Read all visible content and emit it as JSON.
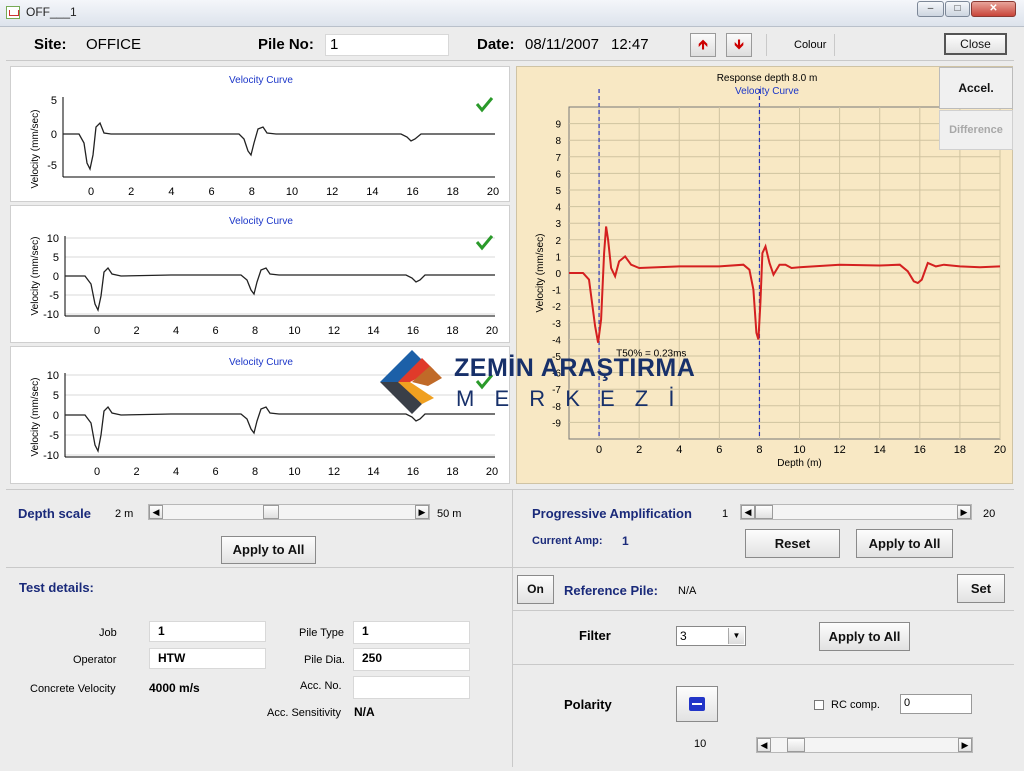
{
  "window": {
    "title": "OFF___1"
  },
  "header": {
    "site_label": "Site:",
    "site_value": "OFFICE",
    "pile_label": "Pile No:",
    "pile_value": "1",
    "date_label": "Date:",
    "date_value": "08/11/2007",
    "time_value": "12:47",
    "colour_label": "Colour",
    "close_label": "Close"
  },
  "small_charts": [
    {
      "title": "Velocity Curve",
      "ylabel": "Velocity (mm/sec)",
      "yticks": [
        "5",
        "0",
        "-5"
      ],
      "xticks": [
        "0",
        "2",
        "4",
        "6",
        "8",
        "10",
        "12",
        "14",
        "16",
        "18",
        "20"
      ],
      "checked": true
    },
    {
      "title": "Velocity Curve",
      "ylabel": "Velocity (mm/sec)",
      "yticks": [
        "10",
        "5",
        "0",
        "-5",
        "-10"
      ],
      "xticks": [
        "0",
        "2",
        "4",
        "6",
        "8",
        "10",
        "12",
        "14",
        "16",
        "18",
        "20"
      ],
      "checked": true
    },
    {
      "title": "Velocity Curve",
      "ylabel": "Velocity (mm/sec)",
      "yticks": [
        "10",
        "5",
        "0",
        "-5",
        "-10"
      ],
      "xticks": [
        "0",
        "2",
        "4",
        "6",
        "8",
        "10",
        "12",
        "14",
        "16",
        "18",
        "20"
      ],
      "checked": true
    }
  ],
  "chart_data": {
    "type": "line",
    "title": "Response depth 8.0 m",
    "subtitle": "Velocity Curve",
    "xlabel": "Depth (m)",
    "ylabel": "Velocity (mm/sec)",
    "xlim": [
      -1.5,
      20
    ],
    "ylim": [
      -10,
      10
    ],
    "xticks": [
      0,
      2,
      4,
      6,
      8,
      10,
      12,
      14,
      16,
      18,
      20
    ],
    "yticks": [
      9,
      8,
      7,
      6,
      5,
      4,
      3,
      2,
      1,
      0,
      -1,
      -2,
      -3,
      -4,
      -5,
      -6,
      -7,
      -8,
      -9
    ],
    "annotation": "T50% = 0.23ms",
    "markers": [
      0,
      8
    ],
    "grid": true,
    "series": [
      {
        "x": [
          -1.5,
          -0.8,
          -0.5,
          -0.2,
          -0.05,
          0.1,
          0.25,
          0.35,
          0.45,
          0.6,
          0.8,
          1.0,
          1.3,
          1.6,
          2.0,
          4.0,
          6.0,
          7.2,
          7.5,
          7.7,
          7.85,
          7.95,
          8.05,
          8.15,
          8.3,
          8.5,
          8.7,
          9.0,
          9.3,
          9.6,
          10.0,
          12.0,
          14.0,
          15.0,
          15.4,
          15.7,
          15.9,
          16.1,
          16.4,
          16.8,
          17.2,
          18.0,
          19.0,
          20.0
        ],
        "y": [
          0.0,
          0.0,
          -0.4,
          -3.2,
          -4.2,
          -2.8,
          1.2,
          2.8,
          2.0,
          0.3,
          -0.2,
          0.7,
          1.0,
          0.5,
          0.3,
          0.4,
          0.4,
          0.5,
          0.2,
          -1.0,
          -3.6,
          -4.0,
          -1.8,
          1.2,
          1.6,
          0.6,
          -0.1,
          0.5,
          0.5,
          0.3,
          0.35,
          0.5,
          0.45,
          0.5,
          0.1,
          -0.5,
          -0.6,
          -0.4,
          0.6,
          0.4,
          0.5,
          0.4,
          0.35,
          0.4
        ]
      }
    ]
  },
  "side_buttons": {
    "accel": "Accel.",
    "difference": "Difference"
  },
  "watermark": {
    "line1": "ZEMİN ARAŞTIRMA",
    "line2": "M E R K E Z İ"
  },
  "depth": {
    "label": "Depth scale",
    "min": "2 m",
    "max": "50 m",
    "apply": "Apply to All",
    "level_fraction": 0.42
  },
  "amplification": {
    "label": "Progressive Amplification",
    "min": "1",
    "max": "20",
    "current_label": "Current Amp:",
    "current_value": "1",
    "reset": "Reset",
    "apply": "Apply to All"
  },
  "test_details": {
    "label": "Test details:",
    "job_label": "Job",
    "job_value": "1",
    "operator_label": "Operator",
    "operator_value": "HTW",
    "concrete_label": "Concrete Velocity",
    "concrete_value": "4000 m/s",
    "pile_type_label": "Pile Type",
    "pile_type_value": "1",
    "pile_dia_label": "Pile Dia.",
    "pile_dia_value": "250",
    "acc_no_label": "Acc. No.",
    "acc_no_value": "",
    "acc_sens_label": "Acc. Sensitivity",
    "acc_sens_value": "N/A"
  },
  "reference": {
    "on_label": "On",
    "label": "Reference Pile:",
    "value": "N/A",
    "set_label": "Set"
  },
  "filter": {
    "label": "Filter",
    "value": "3",
    "apply": "Apply to All"
  },
  "polarity": {
    "label": "Polarity",
    "rc_label": "RC comp.",
    "rc_value": "0",
    "slider_value": "10"
  }
}
